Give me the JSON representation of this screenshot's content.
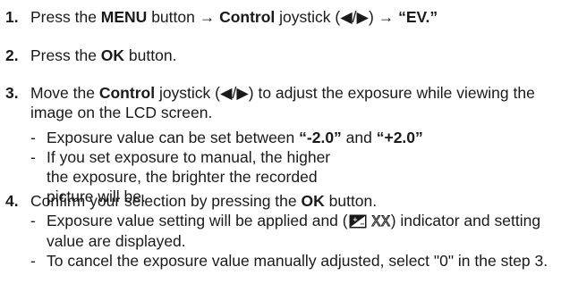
{
  "step1": {
    "number": "1.",
    "text_press": "Press the ",
    "menu": "MENU",
    "text_button_arrow": " button → ",
    "control": "Control",
    "text_joystick": " joystick (◀/▶) → ",
    "ev": "“EV.”"
  },
  "step2": {
    "number": "2.",
    "text_press": "Press the ",
    "ok": "OK",
    "text_button": " button."
  },
  "step3": {
    "number": "3.",
    "text_move": "Move the ",
    "control": "Control",
    "text_rest": " joystick (◀/▶) to adjust the exposure while viewing the image on the LCD screen.",
    "bullet1": {
      "dash": "-",
      "text_a": "Exposure value can be set between ",
      "min": "“-2.0”",
      "text_and": " and ",
      "max": "“+2.0”"
    },
    "bullet2": {
      "dash": "-",
      "text": "If you set exposure to manual, the higher the exposure, the brighter the recorded picture will be."
    }
  },
  "step4": {
    "number": "4.",
    "text_confirm": "Confirm your selection by pressing the ",
    "ok": "OK",
    "text_button": " button.",
    "bullet1": {
      "dash": "-",
      "text_a": "Exposure value setting will be applied and (",
      "icon": "exposure-compensation-icon",
      "xx": "XX",
      "text_b": ") indicator and setting value are displayed."
    },
    "bullet2": {
      "dash": "-",
      "text": "To cancel the exposure value manually adjusted, select \"0\" in the step 3."
    }
  }
}
